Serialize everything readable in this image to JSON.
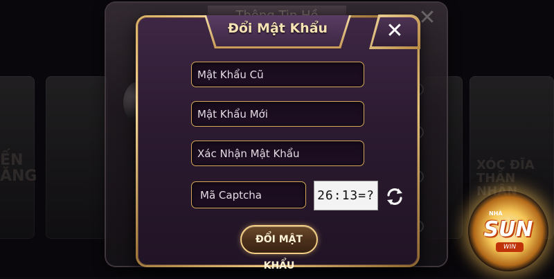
{
  "background": {
    "panel_title": "Thông Tin Hồ",
    "left_card_text": "ẾN ĂNG",
    "right_card_text": "XÓC ĐĨA THẦN NHÂN"
  },
  "dialog": {
    "title": "Đổi Mật Khẩu",
    "close_label": "✕",
    "old_password_placeholder": "Mật Khẩu Cũ",
    "new_password_placeholder": "Mật Khẩu Mới",
    "confirm_password_placeholder": "Xác Nhận Mật Khẩu",
    "captcha_placeholder": "Mã Captcha",
    "captcha_challenge": "26:13=?",
    "submit_label": "ĐỔI MẬT KHẨU"
  },
  "logo": {
    "top_text": "NHÀ",
    "main_text": "SUN",
    "sub_text": "WIN"
  },
  "icons": {
    "close": "close-icon",
    "refresh": "refresh-icon"
  },
  "colors": {
    "gold_border": "#d7a95a",
    "dialog_bg": "#2b1a30",
    "title_text": "#f6e2b4"
  }
}
